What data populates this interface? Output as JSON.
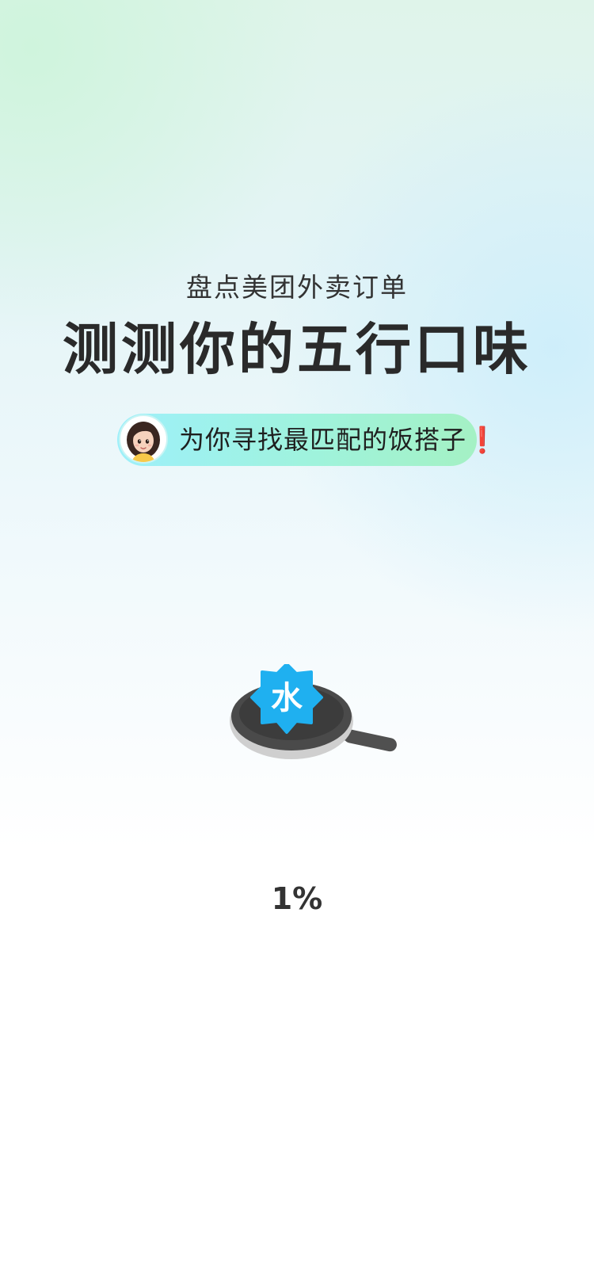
{
  "header": {
    "subtitle": "盘点美团外卖订单",
    "title": "测测你的五行口味"
  },
  "banner": {
    "text": "为你寻找最匹配的饭搭子❗",
    "avatar_icon": "girl-avatar-icon"
  },
  "loader": {
    "badge_char": "水",
    "badge_icon": "star-badge-icon",
    "pan_icon": "frying-pan-icon",
    "progress": 1,
    "progress_text": "1%",
    "badge_color": "#1fb0f0"
  }
}
